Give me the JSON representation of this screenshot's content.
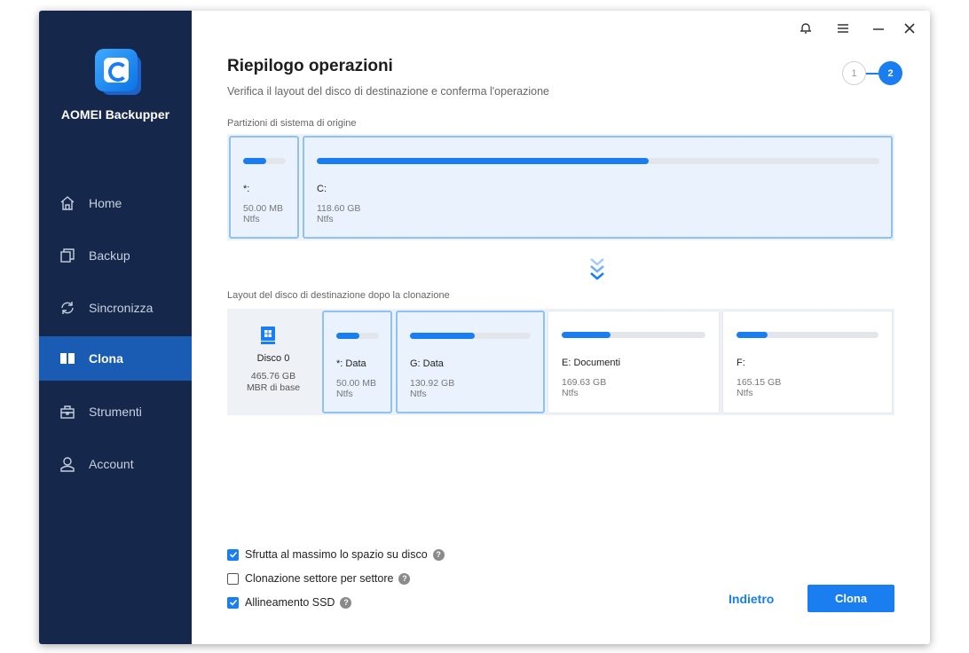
{
  "app": {
    "name": "AOMEI Backupper"
  },
  "sidebar": {
    "items": [
      {
        "label": "Home",
        "icon": "home-icon",
        "active": false
      },
      {
        "label": "Backup",
        "icon": "backup-icon",
        "active": false
      },
      {
        "label": "Sincronizza",
        "icon": "sync-icon",
        "active": false
      },
      {
        "label": "Clona",
        "icon": "clone-icon",
        "active": true
      },
      {
        "label": "Strumenti",
        "icon": "tools-icon",
        "active": false
      },
      {
        "label": "Account",
        "icon": "account-icon",
        "active": false
      }
    ]
  },
  "header": {
    "title": "Riepilogo operazioni",
    "subtitle": "Verifica il layout del disco di destinazione e conferma l'operazione",
    "steps": [
      "1",
      "2"
    ],
    "current_step": 2
  },
  "source": {
    "label": "Partizioni di sistema di origine",
    "partitions": [
      {
        "name": "*:",
        "size": "50.00 MB",
        "fs": "Ntfs",
        "used_fraction": 0.55
      },
      {
        "name": "C:",
        "size": "118.60 GB",
        "fs": "Ntfs",
        "used_fraction": 0.59
      }
    ]
  },
  "destination": {
    "label": "Layout del disco di destinazione dopo la clonazione",
    "disk": {
      "name": "Disco 0",
      "size": "465.76 GB",
      "type": "MBR di base"
    },
    "partitions": [
      {
        "name": "*: Data",
        "size": "50.00 MB",
        "fs": "Ntfs",
        "used_fraction": 0.55
      },
      {
        "name": "G: Data",
        "size": "130.92 GB",
        "fs": "Ntfs",
        "used_fraction": 0.54
      },
      {
        "name": "E: Documenti",
        "size": "169.63 GB",
        "fs": "Ntfs",
        "used_fraction": 0.34
      },
      {
        "name": "F:",
        "size": "165.15 GB",
        "fs": "Ntfs",
        "used_fraction": 0.22
      }
    ]
  },
  "options": [
    {
      "label": "Sfrutta al massimo lo spazio su disco",
      "checked": true
    },
    {
      "label": "Clonazione settore per settore",
      "checked": false
    },
    {
      "label": "Allineamento SSD",
      "checked": true
    }
  ],
  "buttons": {
    "back": "Indietro",
    "clone": "Clona"
  },
  "colors": {
    "sidebar": "#15284b",
    "active": "#1a5bb3",
    "accent": "#1a7ef0"
  }
}
